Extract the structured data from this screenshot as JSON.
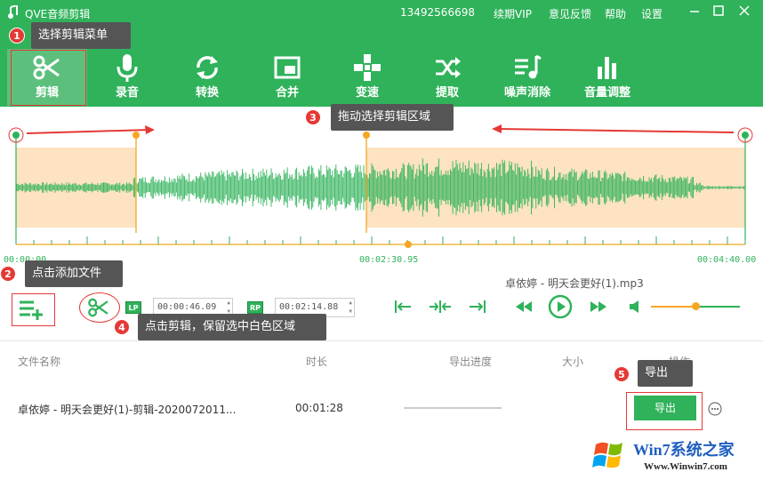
{
  "app": {
    "title": "QVE音频剪辑",
    "phone": "13492566698",
    "menu": [
      "续期VIP",
      "意见反馈",
      "帮助",
      "设置"
    ]
  },
  "toolbar": [
    {
      "label": "剪辑",
      "icon": "scissors-icon",
      "active": true
    },
    {
      "label": "录音",
      "icon": "microphone-icon"
    },
    {
      "label": "转换",
      "icon": "convert-icon"
    },
    {
      "label": "合并",
      "icon": "merge-icon"
    },
    {
      "label": "变速",
      "icon": "speed-icon"
    },
    {
      "label": "提取",
      "icon": "shuffle-icon"
    },
    {
      "label": "噪声消除",
      "icon": "noise-icon"
    },
    {
      "label": "音量调整",
      "icon": "volume-bars-icon"
    }
  ],
  "annotations": [
    {
      "num": "1",
      "text": "选择剪辑菜单"
    },
    {
      "num": "2",
      "text": "点击添加文件"
    },
    {
      "num": "3",
      "text": "拖动选择剪辑区域"
    },
    {
      "num": "4",
      "text": "点击剪辑，保留选中白色区域"
    },
    {
      "num": "5",
      "text": "导出"
    }
  ],
  "timeline": {
    "start": "00:00:00",
    "mid": "00:02:30.95",
    "end": "00:04:40.00"
  },
  "editor": {
    "filename": "卓依婷 - 明天会更好(1).mp3",
    "lp_label": "LP",
    "rp_label": "RP",
    "lp_time": "00:00:46.09",
    "rp_time": "00:02:14.88",
    "volume": 0.5
  },
  "table": {
    "headers": [
      "文件名称",
      "时长",
      "导出进度",
      "大小",
      "操作"
    ],
    "rows": [
      {
        "name": "卓依婷 - 明天会更好(1)-剪辑-2020072011...",
        "duration": "00:01:28",
        "progress": 0,
        "size": "",
        "export_label": "导出"
      }
    ]
  },
  "watermark": {
    "brand": "Win7系统之家",
    "url": "Www.Winwin7.com"
  },
  "colors": {
    "accent": "#2fb25a",
    "selection": "#fde3c2",
    "handle": "#f5a623",
    "annotation": "#e53935"
  }
}
